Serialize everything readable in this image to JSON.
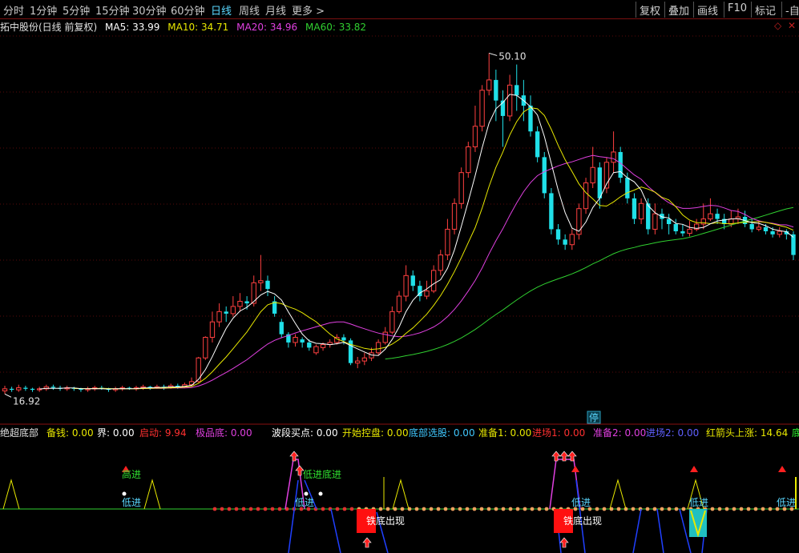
{
  "toolbar": {
    "periods": [
      "分时",
      "1分钟",
      "5分钟",
      "15分钟",
      "30分钟",
      "60分钟",
      "日线",
      "周线",
      "月线",
      "更多 >"
    ],
    "active": "日线",
    "right_buttons": [
      "复权",
      "叠加",
      "画线",
      "F10",
      "标记",
      "-自"
    ]
  },
  "info": {
    "stock": "拓中股份(日线 前复权)",
    "ma5": "MA5: 33.99",
    "ma10": "MA10: 34.71",
    "ma20": "MA20: 34.96",
    "ma60": "MA60: 33.82"
  },
  "price_labels": {
    "high": "50.10",
    "low": "16.92",
    "stop": "停"
  },
  "indicator": {
    "name": "绝超底部",
    "items": [
      {
        "label": "备钱: 0.00",
        "color": "#e8e800"
      },
      {
        "label": "界: 0.00",
        "color": "#ffffff"
      },
      {
        "label": "启动: 9.94",
        "color": "#ff3030"
      },
      {
        "label": "极品底: 0.00",
        "color": "#e040e0"
      },
      {
        "label": "波段买点: 0.00",
        "color": "#ffffff"
      },
      {
        "label": "开始控盘: 0.00",
        "color": "#e8e800"
      },
      {
        "label": "底部选股: 0.00",
        "color": "#40c8ff"
      },
      {
        "label": "准备1: 0.00",
        "color": "#e8e800"
      },
      {
        "label": "进场1: 0.00",
        "color": "#ff3030"
      },
      {
        "label": "准备2: 0.00",
        "color": "#e040e0"
      },
      {
        "label": "进场2: 0.00",
        "color": "#6060ff"
      },
      {
        "label": "红箭头上涨: 14.64",
        "color": "#e8e800"
      },
      {
        "label": "底",
        "color": "#30ff30"
      }
    ]
  },
  "signals": {
    "low_entry": "低进",
    "high_entry": "高进",
    "bottom_entry": "底进",
    "iron_bottom": "铁底出现",
    "iron_box": "铁"
  },
  "colors": {
    "up": "#ff4040",
    "down": "#20e0e8",
    "ma5": "#ffffff",
    "ma10": "#e8e800",
    "ma20": "#e040e0",
    "ma60": "#30d030"
  },
  "chart_data": {
    "type": "candlestick",
    "title": "拓中股份(日线 前复权)",
    "ylim": [
      15,
      52
    ],
    "candles": [
      {
        "o": 17.3,
        "c": 17.5,
        "h": 17.8,
        "l": 17.0
      },
      {
        "o": 17.5,
        "c": 17.4,
        "h": 17.7,
        "l": 17.2
      },
      {
        "o": 17.4,
        "c": 17.6,
        "h": 17.9,
        "l": 17.2
      },
      {
        "o": 17.6,
        "c": 17.5,
        "h": 17.8,
        "l": 17.3
      },
      {
        "o": 17.5,
        "c": 17.4,
        "h": 17.6,
        "l": 17.2
      },
      {
        "o": 17.4,
        "c": 17.5,
        "h": 17.7,
        "l": 17.2
      },
      {
        "o": 17.5,
        "c": 17.7,
        "h": 17.9,
        "l": 17.3
      },
      {
        "o": 17.7,
        "c": 17.6,
        "h": 17.9,
        "l": 17.4
      },
      {
        "o": 17.6,
        "c": 17.5,
        "h": 17.8,
        "l": 17.3
      },
      {
        "o": 17.5,
        "c": 17.6,
        "h": 17.8,
        "l": 17.3
      },
      {
        "o": 17.6,
        "c": 17.5,
        "h": 17.7,
        "l": 17.3
      },
      {
        "o": 17.5,
        "c": 17.4,
        "h": 17.6,
        "l": 17.2
      },
      {
        "o": 17.4,
        "c": 17.5,
        "h": 17.7,
        "l": 17.2
      },
      {
        "o": 17.5,
        "c": 17.6,
        "h": 17.8,
        "l": 17.3
      },
      {
        "o": 17.6,
        "c": 17.5,
        "h": 17.8,
        "l": 17.4
      },
      {
        "o": 17.5,
        "c": 17.4,
        "h": 17.6,
        "l": 17.2
      },
      {
        "o": 17.4,
        "c": 17.5,
        "h": 17.7,
        "l": 17.2
      },
      {
        "o": 17.5,
        "c": 17.6,
        "h": 17.8,
        "l": 17.3
      },
      {
        "o": 17.6,
        "c": 17.5,
        "h": 17.7,
        "l": 17.4
      },
      {
        "o": 17.5,
        "c": 17.6,
        "h": 17.8,
        "l": 17.3
      },
      {
        "o": 17.6,
        "c": 17.7,
        "h": 17.9,
        "l": 17.4
      },
      {
        "o": 17.7,
        "c": 17.6,
        "h": 17.8,
        "l": 17.4
      },
      {
        "o": 17.6,
        "c": 17.7,
        "h": 17.9,
        "l": 17.5
      },
      {
        "o": 17.7,
        "c": 17.6,
        "h": 17.9,
        "l": 17.4
      },
      {
        "o": 17.6,
        "c": 17.8,
        "h": 18.0,
        "l": 17.5
      },
      {
        "o": 17.8,
        "c": 17.7,
        "h": 18.0,
        "l": 17.5
      },
      {
        "o": 17.7,
        "c": 17.9,
        "h": 18.1,
        "l": 17.6
      },
      {
        "o": 17.9,
        "c": 18.2,
        "h": 18.6,
        "l": 17.7
      },
      {
        "o": 18.2,
        "c": 20.5,
        "h": 20.6,
        "l": 18.1
      },
      {
        "o": 20.5,
        "c": 22.5,
        "h": 22.6,
        "l": 20.3
      },
      {
        "o": 22.5,
        "c": 24.0,
        "h": 25.0,
        "l": 22.0
      },
      {
        "o": 24.0,
        "c": 25.0,
        "h": 25.8,
        "l": 23.5
      },
      {
        "o": 25.0,
        "c": 24.8,
        "h": 25.5,
        "l": 24.0
      },
      {
        "o": 24.8,
        "c": 25.5,
        "h": 26.5,
        "l": 24.5
      },
      {
        "o": 25.5,
        "c": 26.0,
        "h": 26.8,
        "l": 25.0
      },
      {
        "o": 26.0,
        "c": 25.8,
        "h": 26.5,
        "l": 25.2
      },
      {
        "o": 25.8,
        "c": 27.8,
        "h": 28.5,
        "l": 25.5
      },
      {
        "o": 27.8,
        "c": 28.0,
        "h": 30.5,
        "l": 27.0
      },
      {
        "o": 28.0,
        "c": 27.2,
        "h": 28.5,
        "l": 26.5
      },
      {
        "o": 26.0,
        "c": 24.8,
        "h": 26.5,
        "l": 24.5
      },
      {
        "o": 24.0,
        "c": 22.8,
        "h": 24.3,
        "l": 22.5
      },
      {
        "o": 22.8,
        "c": 22.0,
        "h": 23.0,
        "l": 21.5
      },
      {
        "o": 22.0,
        "c": 22.5,
        "h": 22.8,
        "l": 21.6
      },
      {
        "o": 22.3,
        "c": 22.0,
        "h": 22.5,
        "l": 21.5
      },
      {
        "o": 22.0,
        "c": 21.5,
        "h": 22.3,
        "l": 21.2
      },
      {
        "o": 21.0,
        "c": 21.6,
        "h": 21.8,
        "l": 20.8
      },
      {
        "o": 21.5,
        "c": 21.8,
        "h": 22.0,
        "l": 21.2
      },
      {
        "o": 21.8,
        "c": 22.0,
        "h": 22.3,
        "l": 21.5
      },
      {
        "o": 22.0,
        "c": 22.5,
        "h": 22.8,
        "l": 21.8
      },
      {
        "o": 22.5,
        "c": 22.2,
        "h": 22.8,
        "l": 21.8
      },
      {
        "o": 22.2,
        "c": 20.0,
        "h": 22.4,
        "l": 19.8
      },
      {
        "o": 20.0,
        "c": 20.2,
        "h": 20.6,
        "l": 19.5
      },
      {
        "o": 20.2,
        "c": 20.5,
        "h": 21.0,
        "l": 19.8
      },
      {
        "o": 20.5,
        "c": 21.0,
        "h": 21.5,
        "l": 20.2
      },
      {
        "o": 21.0,
        "c": 22.0,
        "h": 22.3,
        "l": 20.8
      },
      {
        "o": 22.0,
        "c": 23.0,
        "h": 23.5,
        "l": 21.8
      },
      {
        "o": 23.0,
        "c": 25.0,
        "h": 25.5,
        "l": 22.8
      },
      {
        "o": 25.0,
        "c": 26.5,
        "h": 27.0,
        "l": 24.8
      },
      {
        "o": 26.5,
        "c": 28.5,
        "h": 29.5,
        "l": 26.0
      },
      {
        "o": 28.5,
        "c": 27.5,
        "h": 29.0,
        "l": 27.0
      },
      {
        "o": 27.5,
        "c": 26.5,
        "h": 28.0,
        "l": 26.0
      },
      {
        "o": 26.5,
        "c": 27.0,
        "h": 28.0,
        "l": 26.2
      },
      {
        "o": 27.0,
        "c": 29.0,
        "h": 29.5,
        "l": 26.8
      },
      {
        "o": 29.0,
        "c": 30.5,
        "h": 31.0,
        "l": 28.5
      },
      {
        "o": 30.5,
        "c": 33.0,
        "h": 34.0,
        "l": 30.0
      },
      {
        "o": 33.0,
        "c": 35.5,
        "h": 36.0,
        "l": 32.5
      },
      {
        "o": 35.5,
        "c": 38.5,
        "h": 39.0,
        "l": 35.0
      },
      {
        "o": 38.5,
        "c": 41.0,
        "h": 41.5,
        "l": 38.0
      },
      {
        "o": 41.0,
        "c": 43.0,
        "h": 45.0,
        "l": 40.5
      },
      {
        "o": 43.0,
        "c": 46.5,
        "h": 47.0,
        "l": 42.5
      },
      {
        "o": 46.5,
        "c": 47.5,
        "h": 50.1,
        "l": 46.0
      },
      {
        "o": 47.5,
        "c": 45.5,
        "h": 48.5,
        "l": 43.5
      },
      {
        "o": 45.5,
        "c": 44.0,
        "h": 46.5,
        "l": 41.0
      },
      {
        "o": 44.0,
        "c": 47.0,
        "h": 48.0,
        "l": 43.5
      },
      {
        "o": 47.0,
        "c": 46.0,
        "h": 49.0,
        "l": 44.5
      },
      {
        "o": 46.0,
        "c": 45.0,
        "h": 47.5,
        "l": 43.5
      },
      {
        "o": 45.0,
        "c": 42.5,
        "h": 46.0,
        "l": 42.0
      },
      {
        "o": 42.5,
        "c": 40.0,
        "h": 43.0,
        "l": 39.5
      },
      {
        "o": 40.0,
        "c": 36.5,
        "h": 40.5,
        "l": 36.0
      },
      {
        "o": 36.5,
        "c": 33.0,
        "h": 37.0,
        "l": 32.5
      },
      {
        "o": 33.0,
        "c": 32.0,
        "h": 33.5,
        "l": 31.5
      },
      {
        "o": 32.0,
        "c": 31.5,
        "h": 32.5,
        "l": 31.0
      },
      {
        "o": 31.5,
        "c": 32.5,
        "h": 33.0,
        "l": 31.0
      },
      {
        "o": 32.5,
        "c": 35.0,
        "h": 35.5,
        "l": 32.0
      },
      {
        "o": 35.0,
        "c": 37.5,
        "h": 38.0,
        "l": 34.5
      },
      {
        "o": 37.5,
        "c": 39.0,
        "h": 41.0,
        "l": 37.0
      },
      {
        "o": 39.0,
        "c": 36.0,
        "h": 39.5,
        "l": 35.0
      },
      {
        "o": 37.0,
        "c": 39.5,
        "h": 40.0,
        "l": 36.5
      },
      {
        "o": 39.5,
        "c": 40.5,
        "h": 42.5,
        "l": 38.5
      },
      {
        "o": 40.5,
        "c": 38.0,
        "h": 41.0,
        "l": 37.5
      },
      {
        "o": 38.0,
        "c": 36.0,
        "h": 38.5,
        "l": 35.5
      },
      {
        "o": 36.0,
        "c": 34.0,
        "h": 36.5,
        "l": 33.5
      },
      {
        "o": 34.0,
        "c": 35.5,
        "h": 36.0,
        "l": 33.5
      },
      {
        "o": 35.5,
        "c": 33.0,
        "h": 36.0,
        "l": 32.5
      },
      {
        "o": 33.0,
        "c": 34.5,
        "h": 35.5,
        "l": 32.5
      },
      {
        "o": 34.5,
        "c": 34.0,
        "h": 35.0,
        "l": 33.0
      },
      {
        "o": 34.0,
        "c": 33.5,
        "h": 34.5,
        "l": 32.5
      },
      {
        "o": 33.5,
        "c": 32.8,
        "h": 34.0,
        "l": 32.5
      },
      {
        "o": 32.8,
        "c": 32.6,
        "h": 33.5,
        "l": 32.3
      },
      {
        "o": 32.6,
        "c": 33.0,
        "h": 33.8,
        "l": 32.3
      },
      {
        "o": 33.0,
        "c": 33.5,
        "h": 34.0,
        "l": 32.8
      },
      {
        "o": 33.5,
        "c": 34.0,
        "h": 35.5,
        "l": 33.0
      },
      {
        "o": 34.0,
        "c": 34.5,
        "h": 36.0,
        "l": 33.8
      },
      {
        "o": 34.5,
        "c": 34.0,
        "h": 35.0,
        "l": 33.5
      },
      {
        "o": 34.0,
        "c": 33.5,
        "h": 34.5,
        "l": 33.0
      },
      {
        "o": 33.5,
        "c": 34.0,
        "h": 34.8,
        "l": 33.2
      },
      {
        "o": 34.0,
        "c": 34.2,
        "h": 35.0,
        "l": 33.5
      },
      {
        "o": 34.2,
        "c": 33.5,
        "h": 34.8,
        "l": 33.2
      },
      {
        "o": 33.5,
        "c": 33.0,
        "h": 34.0,
        "l": 32.7
      },
      {
        "o": 33.0,
        "c": 33.2,
        "h": 33.8,
        "l": 32.8
      },
      {
        "o": 33.2,
        "c": 32.8,
        "h": 33.5,
        "l": 32.5
      },
      {
        "o": 32.8,
        "c": 32.5,
        "h": 33.2,
        "l": 32.2
      },
      {
        "o": 32.5,
        "c": 32.8,
        "h": 33.2,
        "l": 32.2
      },
      {
        "o": 32.8,
        "c": 32.5,
        "h": 33.0,
        "l": 32.0
      },
      {
        "o": 32.5,
        "c": 30.5,
        "h": 32.8,
        "l": 30.0
      }
    ],
    "ma5_label": "MA5: 33.99",
    "ma10_label": "MA10: 34.71",
    "ma20_label": "MA20: 34.96",
    "ma60_label": "MA60: 33.82",
    "high_mark": 50.1,
    "low_mark": 16.92
  }
}
